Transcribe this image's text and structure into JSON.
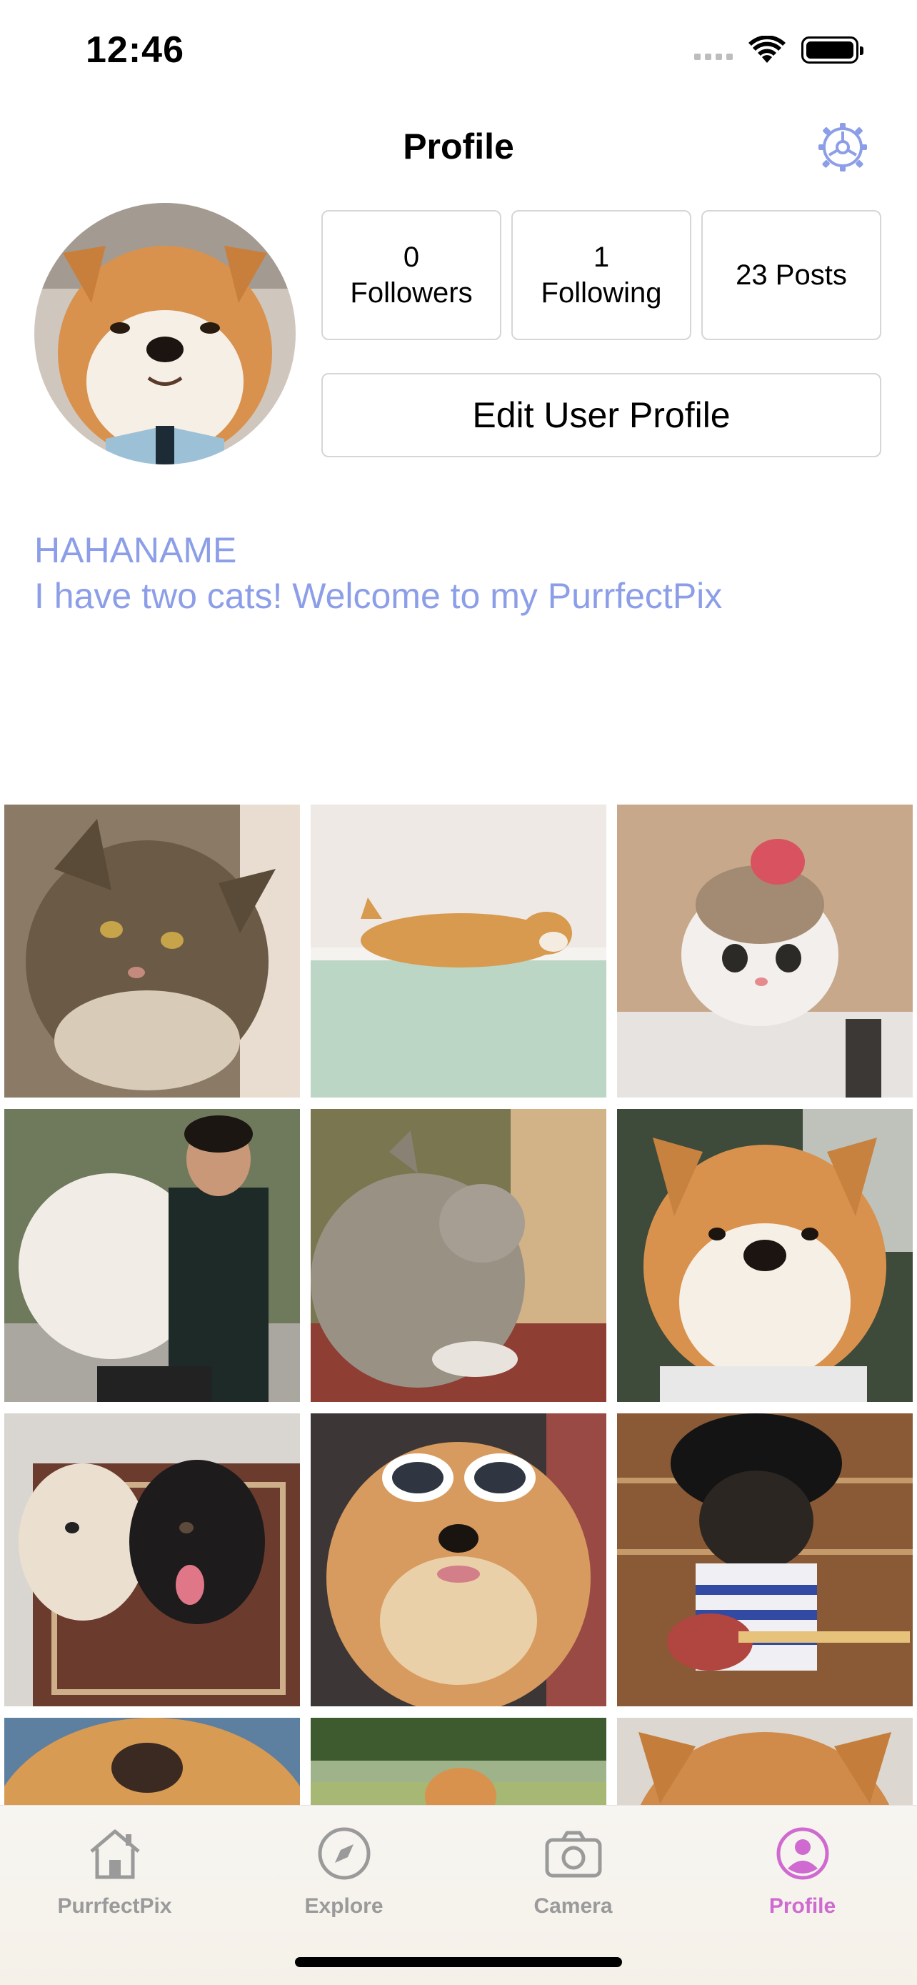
{
  "status_bar": {
    "time": "12:46",
    "icons": [
      "cellular-signal-icon",
      "wifi-icon",
      "battery-icon"
    ]
  },
  "header": {
    "title": "Profile",
    "settings_icon": "gear-icon"
  },
  "profile": {
    "avatar": "shiba-dog-photo",
    "followers_count": "0",
    "followers_label": "Followers",
    "following_count": "1",
    "following_label": "Following",
    "posts_label": "23 Posts",
    "edit_button_label": "Edit User Profile",
    "username": "HAHANAME",
    "bio": "I have two cats! Welcome to my PurrfectPix",
    "accent_color": "#8c9ee8"
  },
  "posts": [
    {
      "subject": "tabby-cat"
    },
    {
      "subject": "shiba-in-bathtub"
    },
    {
      "subject": "cat-with-flamingo-hat"
    },
    {
      "subject": "man-holding-white-dog"
    },
    {
      "subject": "gray-cat-by-window"
    },
    {
      "subject": "shiba-portrait"
    },
    {
      "subject": "two-dogs-on-rug"
    },
    {
      "subject": "chow-with-sunglasses"
    },
    {
      "subject": "pug-with-guitar"
    },
    {
      "subject": "golden-dog-closeup"
    },
    {
      "subject": "dog-on-grass"
    },
    {
      "subject": "shiba-closeup"
    }
  ],
  "tab_bar": {
    "active_color": "#cf6ad0",
    "inactive_color": "#9a9a9a",
    "tabs": [
      {
        "label": "PurrfectPix",
        "icon": "house-icon"
      },
      {
        "label": "Explore",
        "icon": "compass-icon"
      },
      {
        "label": "Camera",
        "icon": "camera-icon"
      },
      {
        "label": "Profile",
        "icon": "person-circle-icon",
        "active": true
      }
    ]
  }
}
